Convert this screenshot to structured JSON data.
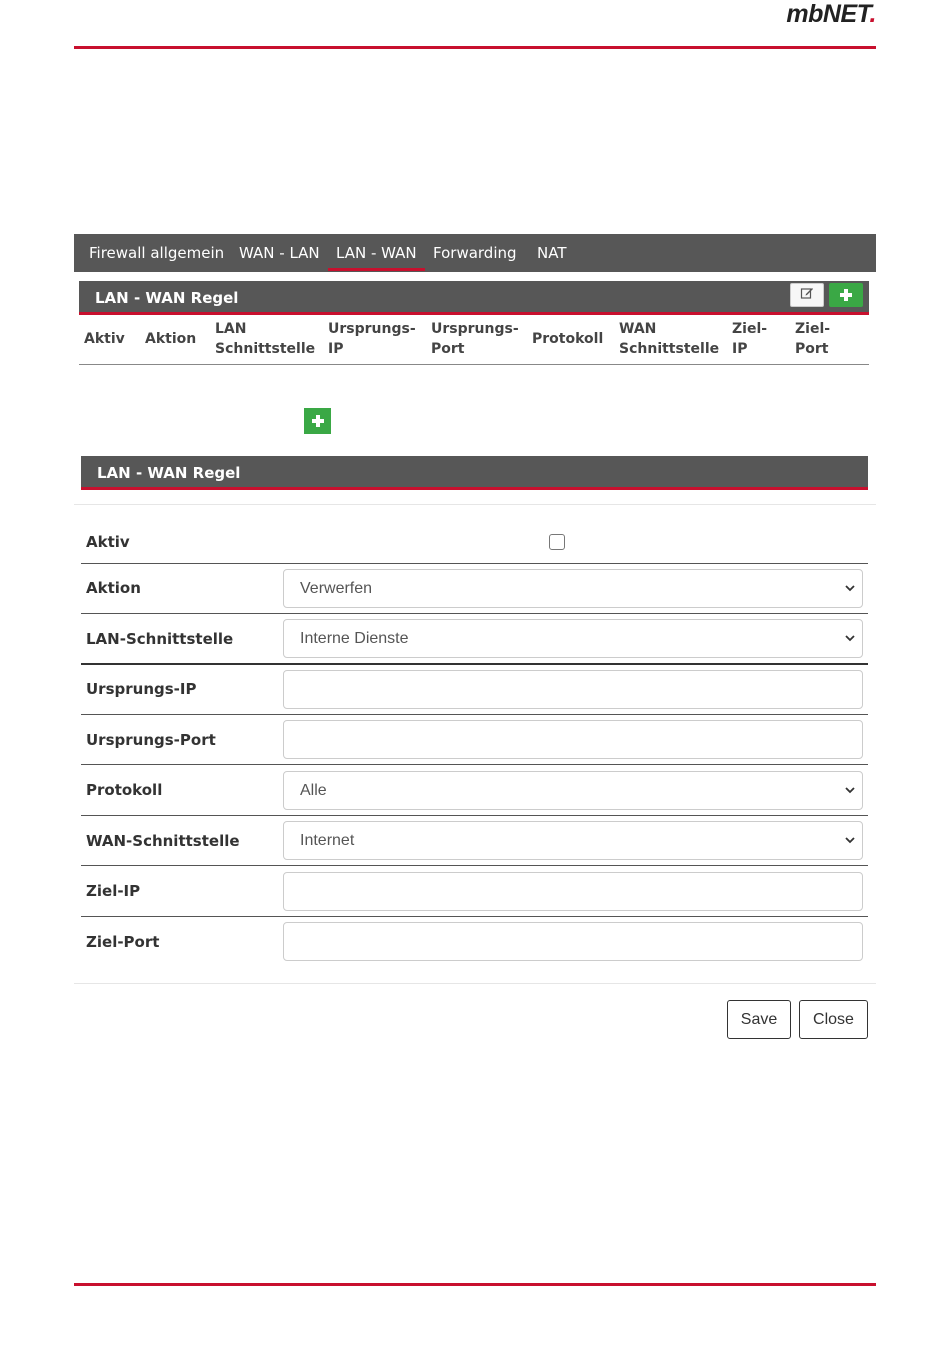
{
  "brand": {
    "logo_text": "mbNET",
    "logo_dot": "."
  },
  "tabs": [
    {
      "label": "Firewall allgemein",
      "active": false
    },
    {
      "label": "WAN - LAN",
      "active": false
    },
    {
      "label": "LAN - WAN",
      "active": true
    },
    {
      "label": "Forwarding",
      "active": false
    },
    {
      "label": "NAT",
      "active": false
    }
  ],
  "rules_panel": {
    "title": "LAN - WAN Regel",
    "edit_icon": "edit-icon",
    "add_icon": "plus-icon",
    "columns": [
      [
        "Aktiv"
      ],
      [
        "Aktion"
      ],
      [
        "LAN",
        "Schnittstelle"
      ],
      [
        "Ursprungs-",
        "IP"
      ],
      [
        "Ursprungs-",
        "Port"
      ],
      [
        "Protokoll"
      ],
      [
        "WAN",
        "Schnittstelle"
      ],
      [
        "Ziel-",
        "IP"
      ],
      [
        "Ziel-",
        "Port"
      ]
    ]
  },
  "editor": {
    "title": "LAN - WAN Regel",
    "fields": {
      "aktiv": {
        "label": "Aktiv",
        "checked": false
      },
      "aktion": {
        "label": "Aktion",
        "value": "Verwerfen"
      },
      "lan_if": {
        "label": "LAN-Schnittstelle",
        "value": "Interne Dienste"
      },
      "src_ip": {
        "label": "Ursprungs-IP",
        "value": ""
      },
      "src_port": {
        "label": "Ursprungs-Port",
        "value": ""
      },
      "protocol": {
        "label": "Protokoll",
        "value": "Alle"
      },
      "wan_if": {
        "label": "WAN-Schnittstelle",
        "value": "Internet"
      },
      "dst_ip": {
        "label": "Ziel-IP",
        "value": ""
      },
      "dst_port": {
        "label": "Ziel-Port",
        "value": ""
      }
    },
    "save_label": "Save",
    "close_label": "Close"
  },
  "colors": {
    "accent": "#c8102e",
    "header_bg": "#575757",
    "add_green": "#3aa845"
  }
}
